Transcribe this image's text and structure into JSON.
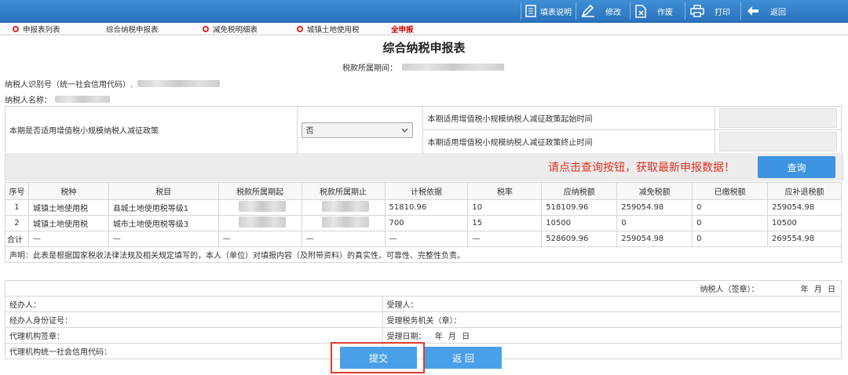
{
  "toolbar": {
    "fill_guide": "填表说明",
    "edit": "修改",
    "void": "作废",
    "print": "打印",
    "back": "返回"
  },
  "tabs": [
    {
      "label": "申报表列表"
    },
    {
      "label": "综合纳税申报表"
    },
    {
      "label": "减免税明细表"
    },
    {
      "label": "城镇土地使用税"
    },
    {
      "label": "全申报"
    }
  ],
  "header": {
    "title": "综合纳税申报表",
    "period_label": "税款所属期间："
  },
  "taxpayer": {
    "id_label": "纳税人识别号（统一社会信用代码）.",
    "name_label": "纳税人名称："
  },
  "policy": {
    "question": "本期是否适用增值税小规模纳税人减征政策",
    "selected": "否",
    "start_label": "本期适用增值税小规模纳税人减征政策起始时间",
    "end_label": "本期适用增值税小规模纳税人减征政策终止时间"
  },
  "query": {
    "hint": "请点击查询按钮，获取最新申报数据！",
    "button": "查询"
  },
  "table": {
    "headers": [
      "序号",
      "税种",
      "税目",
      "税款所属期起",
      "税款所属期止",
      "计税依据",
      "税率",
      "应纳税额",
      "减免税额",
      "已缴税额",
      "应补退税额"
    ],
    "rows": [
      {
        "no": "1",
        "tax": "城镇土地使用税",
        "item": "县城土地使用税等级1",
        "basis": "51810.96",
        "rate": "10",
        "payable": "518109.96",
        "relief": "259054.98",
        "paid": "0",
        "due": "259054.98"
      },
      {
        "no": "2",
        "tax": "城镇土地使用税",
        "item": "城市土地使用税等级3",
        "basis": "700",
        "rate": "15",
        "payable": "10500",
        "relief": "0",
        "paid": "0",
        "due": "10500"
      }
    ],
    "total": {
      "label": "合计",
      "dash": "—",
      "payable": "528609.96",
      "relief": "259054.98",
      "paid": "0",
      "due": "269554.98"
    }
  },
  "declaration": "声明：此表是根据国家税收法律法规及相关规定填写的，本人（单位）对填报内容（及附带资料）的真实性、可靠性、完整性负责。",
  "signature": {
    "taxpayer_seal": "纳税人（签章）：",
    "date_ymd": "年 月 日",
    "agent": "经办人：",
    "receiver": "受理人：",
    "agent_id": "经办人身份证号：",
    "tax_office": "受理税务机关（章）：",
    "agency_seal": "代理机构签章：",
    "accept_date": "受理日期：",
    "accept_ymd": "年 月 日",
    "agency_code": "代理机构统一社会信用代码："
  },
  "actions": {
    "submit": "提交",
    "back": "返 回"
  }
}
